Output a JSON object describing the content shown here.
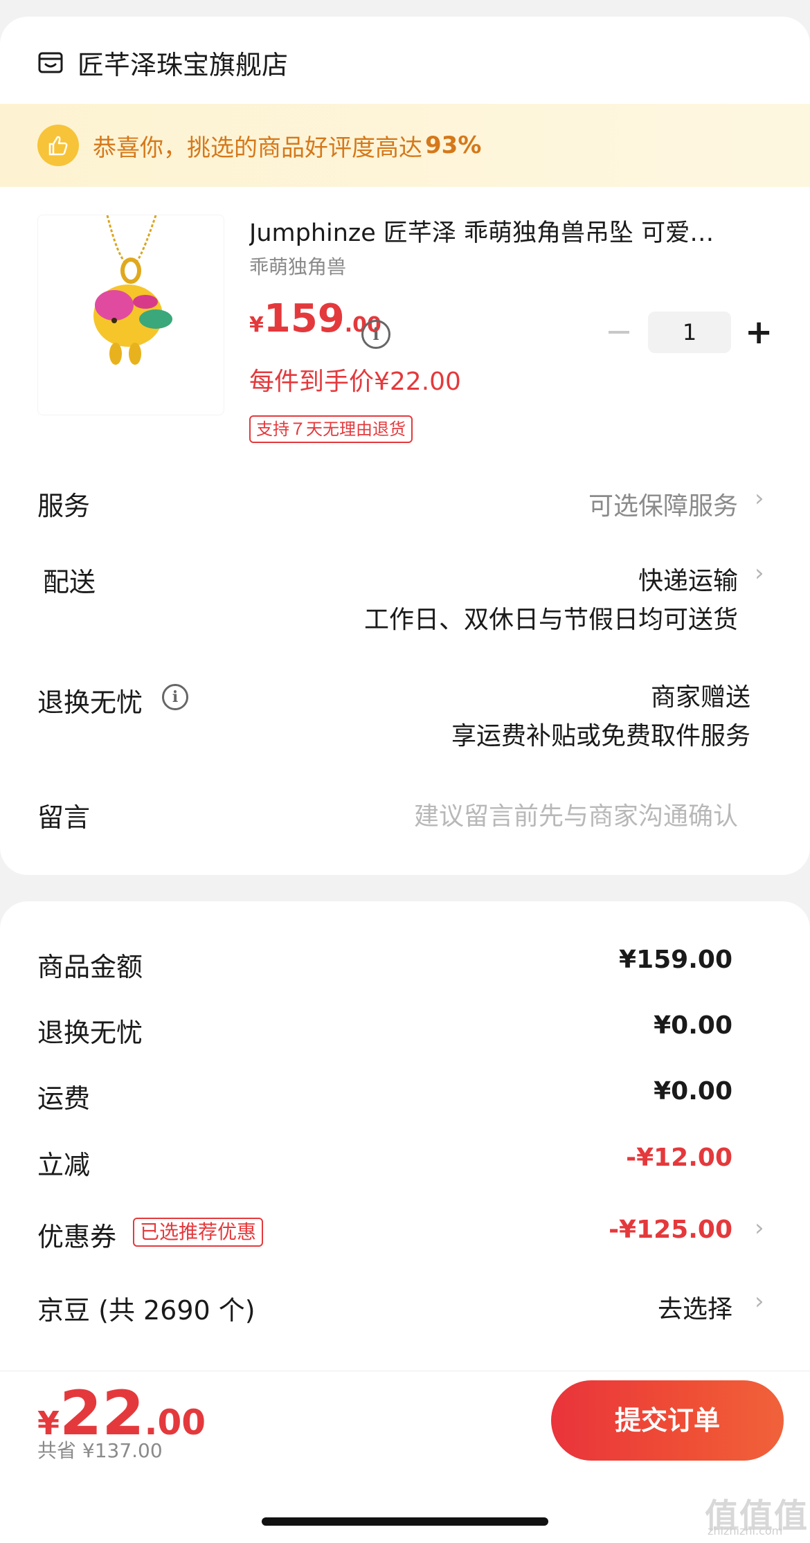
{
  "shop": {
    "name": "匠芊泽珠宝旗舰店",
    "icon": "store-icon"
  },
  "banner": {
    "text": "恭喜你，挑选的商品好评度高达",
    "percent": "93%",
    "icon": "thumbs-up-icon"
  },
  "product": {
    "title": "Jumphinze 匠芊泽 乖萌独角兽吊坠 可爱…",
    "spec": "乖萌独角兽",
    "price_symbol": "¥",
    "price_int": "159",
    "price_dec": ".00",
    "net_price": "每件到手价¥22.00",
    "return_tag": "支持７天无理由退货",
    "quantity": "1",
    "info_icon": "i"
  },
  "rows": {
    "service_label": "服务",
    "service_value": "可选保障服务",
    "delivery_label": "配送",
    "delivery_value": "快递运输",
    "delivery_note": "工作日、双休日与节假日均可送货",
    "worry_label": "退换无忧",
    "worry_value": "商家赠送",
    "worry_note": "享运费补贴或免费取件服务",
    "message_label": "留言",
    "message_placeholder": "建议留言前先与商家沟通确认",
    "chevron": "›"
  },
  "summary": {
    "goods_label": "商品金额",
    "goods_value": "¥159.00",
    "worry_label": "退换无忧",
    "worry_value": "¥0.00",
    "shipping_label": "运费",
    "shipping_value": "¥0.00",
    "discount_label": "立减",
    "discount_value": "-¥12.00",
    "coupon_label": "优惠券",
    "coupon_tag": "已选推荐优惠",
    "coupon_value": "-¥125.00",
    "beans_label": "京豆 (共 2690 个)",
    "beans_value": "去选择"
  },
  "footer": {
    "total_symbol": "¥",
    "total_int": "22",
    "total_dec": ".00",
    "saved": "共省 ¥137.00",
    "submit": "提交订单"
  },
  "watermark": {
    "main": "值值值",
    "sub": "zhizhizhi.com"
  },
  "colors": {
    "accent": "#e4393c",
    "banner_text": "#d5781a",
    "banner_bg": "#fdf3d2"
  }
}
